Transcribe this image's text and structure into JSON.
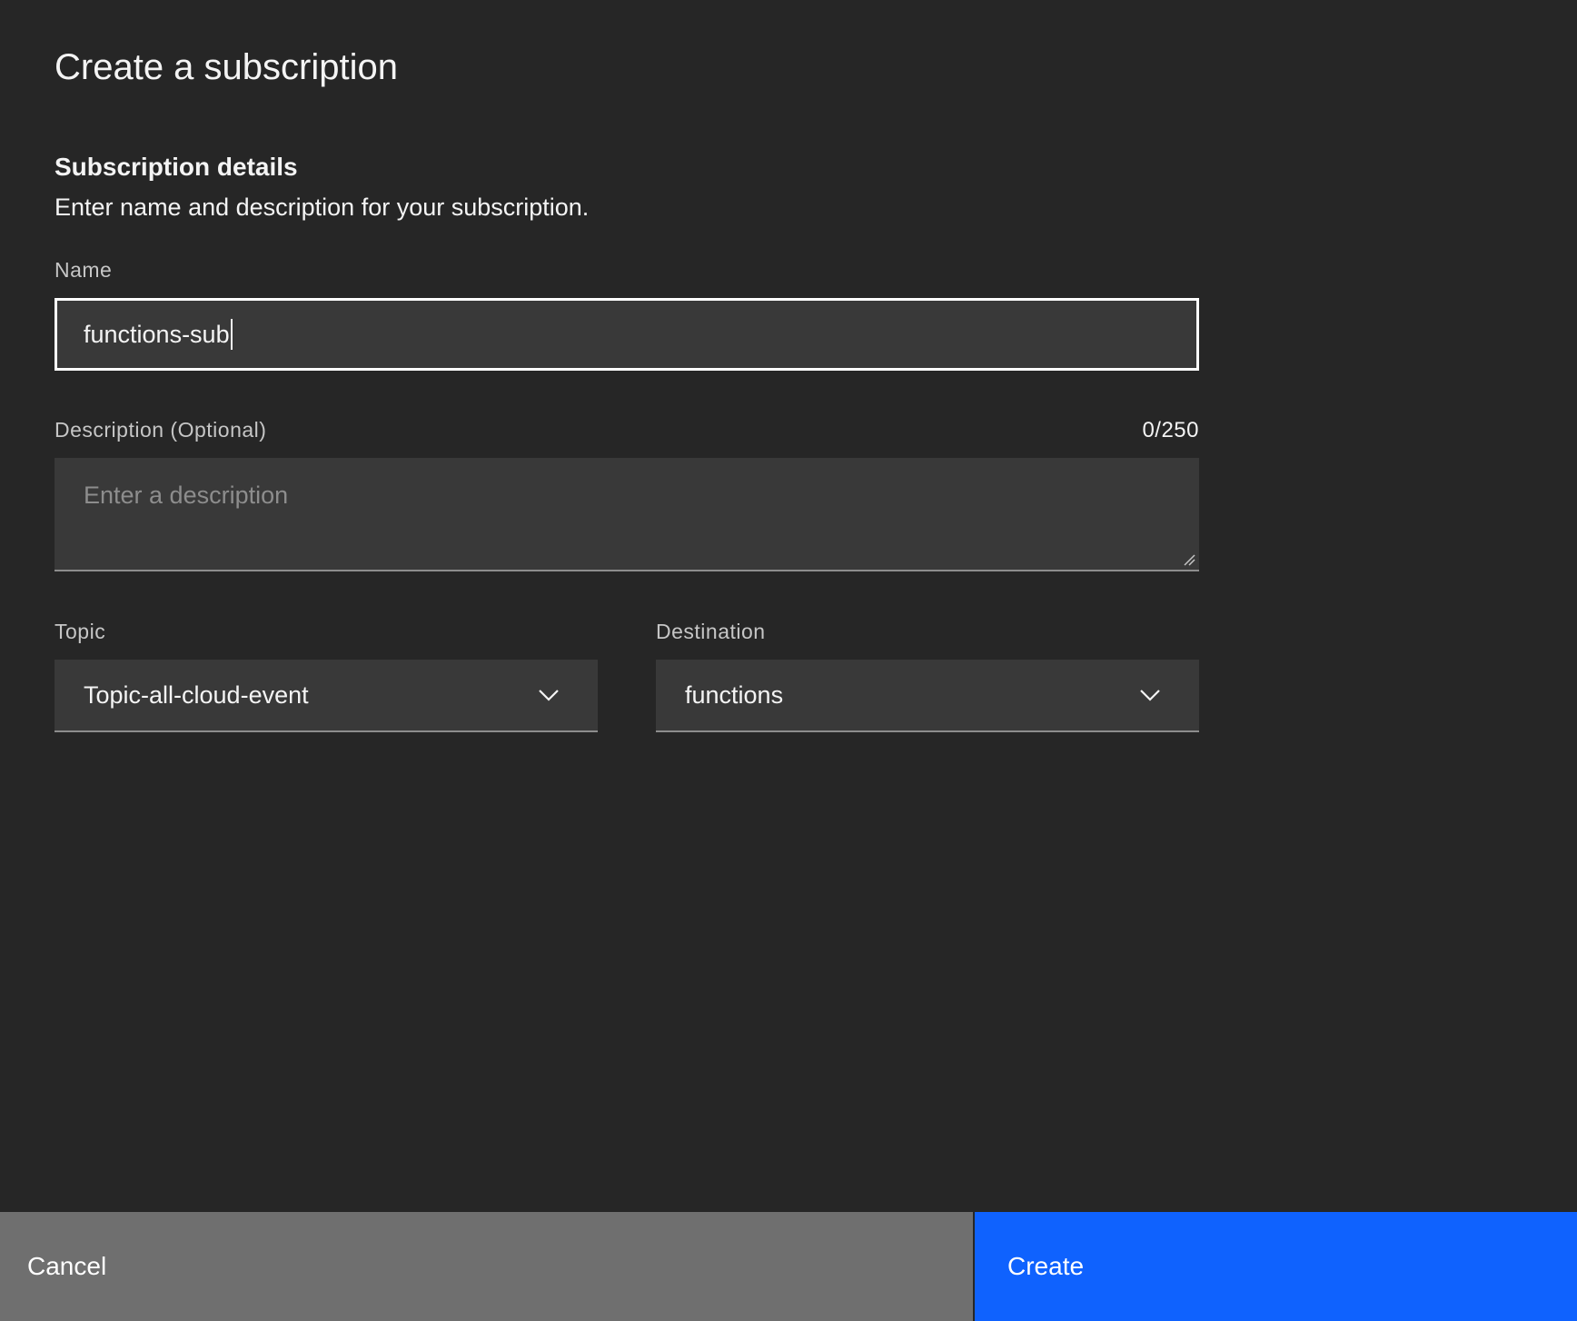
{
  "modal": {
    "title": "Create a subscription",
    "section_heading": "Subscription details",
    "section_description": "Enter name and description for your subscription."
  },
  "form": {
    "name": {
      "label": "Name",
      "value": "functions-sub"
    },
    "description": {
      "label": "Description (Optional)",
      "counter": "0/250",
      "placeholder": "Enter a description",
      "value": ""
    },
    "topic": {
      "label": "Topic",
      "selected": "Topic-all-cloud-event",
      "icon": "chevron-down-icon"
    },
    "destination": {
      "label": "Destination",
      "selected": "functions",
      "icon": "chevron-down-icon"
    }
  },
  "footer": {
    "cancel_label": "Cancel",
    "create_label": "Create"
  },
  "colors": {
    "background": "#262626",
    "field_background": "#393939",
    "primary_button": "#0f62fe",
    "secondary_button": "#6f6f6f",
    "focus_border": "#ffffff"
  }
}
